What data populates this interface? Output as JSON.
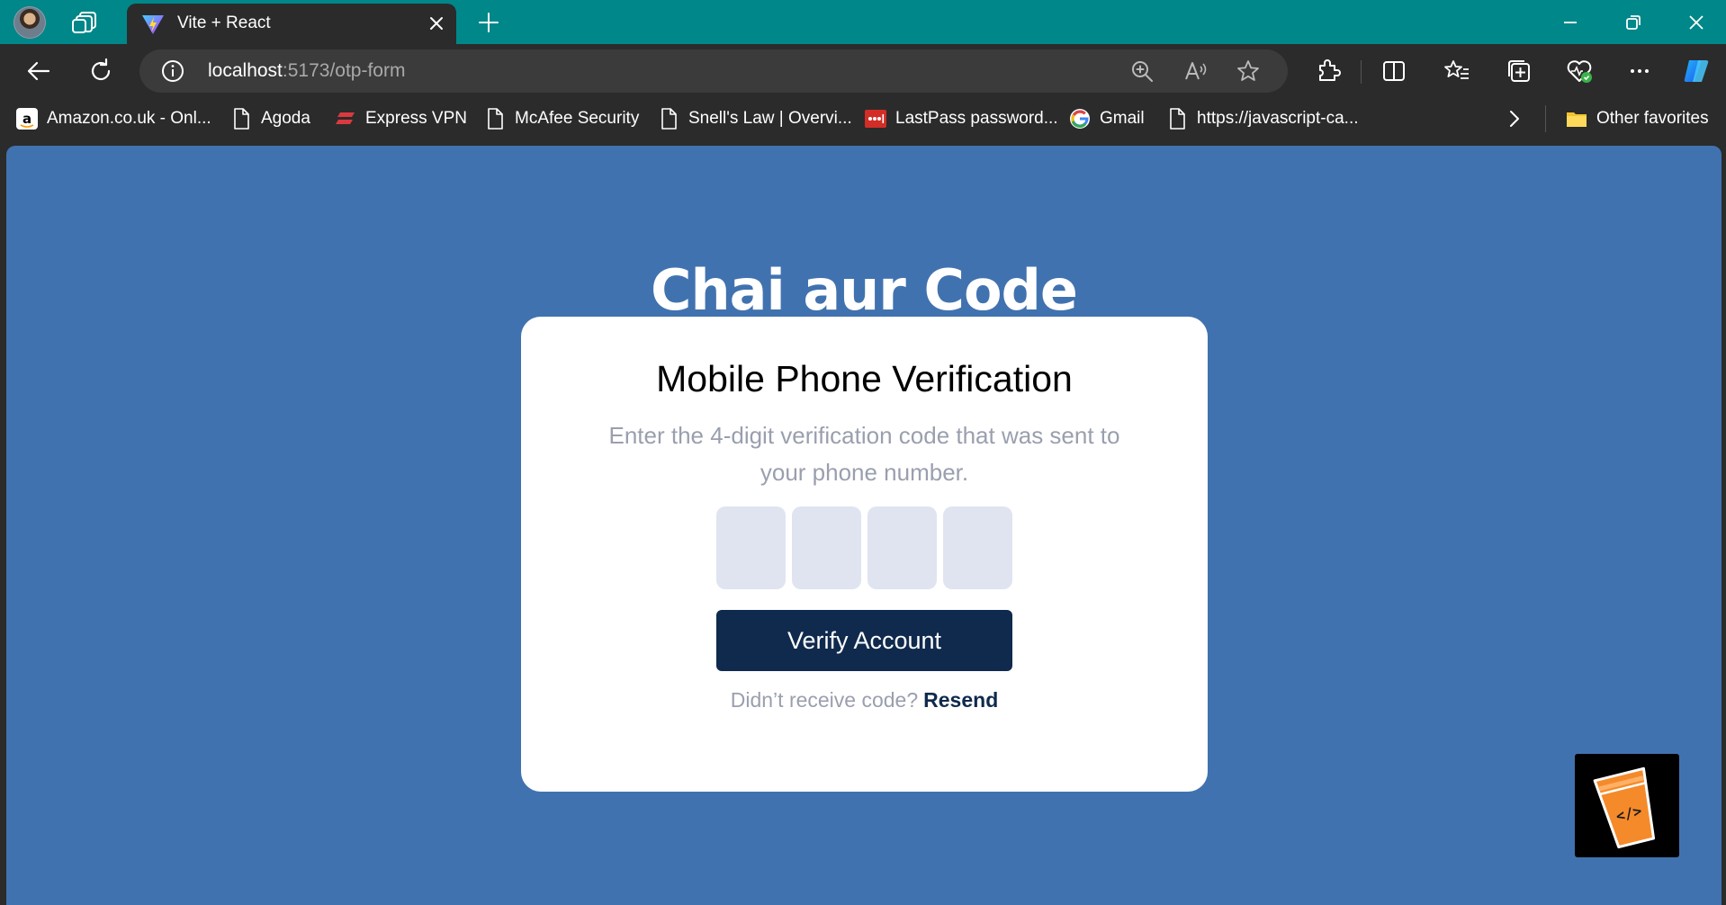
{
  "browser": {
    "tab": {
      "title": "Vite + React"
    },
    "address": {
      "host": "localhost",
      "path": ":5173/otp-form"
    }
  },
  "bookmarks": {
    "items": [
      {
        "label": "Amazon.co.uk - Onl...",
        "icon": "amazon-icon"
      },
      {
        "label": "Agoda",
        "icon": "page-icon"
      },
      {
        "label": "Express VPN",
        "icon": "expressvpn-icon"
      },
      {
        "label": "McAfee Security",
        "icon": "page-icon"
      },
      {
        "label": "Snell's Law | Overvi...",
        "icon": "page-icon"
      },
      {
        "label": "LastPass password...",
        "icon": "lastpass-icon"
      },
      {
        "label": "Gmail",
        "icon": "google-icon"
      },
      {
        "label": "https://javascript-ca...",
        "icon": "page-icon"
      }
    ],
    "other_favorites": "Other favorites"
  },
  "page": {
    "brand_title": "Chai aur Code",
    "card": {
      "title": "Mobile Phone Verification",
      "subtitle": "Enter the 4-digit verification code that was sent to your phone number.",
      "otp_values": [
        "",
        "",
        "",
        ""
      ],
      "verify_label": "Verify Account",
      "resend_prompt": "Didn’t receive code?",
      "resend_link": "Resend"
    }
  },
  "colors": {
    "titlebar": "#008789",
    "page_background": "#4172b0",
    "otp_box": "#dfe4f0",
    "primary_button": "#0f2a4d",
    "muted_text": "#9a9fae"
  }
}
